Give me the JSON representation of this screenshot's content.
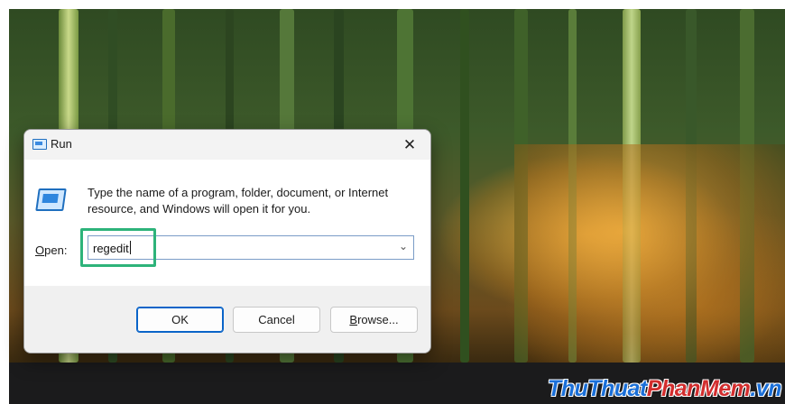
{
  "dialog": {
    "title": "Run",
    "close_glyph": "✕",
    "description": "Type the name of a program, folder, document, or Internet resource, and Windows will open it for you.",
    "open_label_accel": "O",
    "open_label_rest": "pen:",
    "input_value": "regedit",
    "dropdown_glyph": "⌄",
    "buttons": {
      "ok": "OK",
      "cancel": "Cancel",
      "browse_accel": "B",
      "browse_rest": "rowse..."
    }
  },
  "watermark": {
    "part1": "ThuThuat",
    "part2": "PhanMem",
    "part3": ".vn"
  },
  "icons": [
    "run-title-icon",
    "close-icon",
    "run-program-icon",
    "chevron-down-icon"
  ],
  "colors": {
    "highlight": "#2db37a",
    "accent": "#0a64c8",
    "taskbar": "#1b1b1c"
  }
}
